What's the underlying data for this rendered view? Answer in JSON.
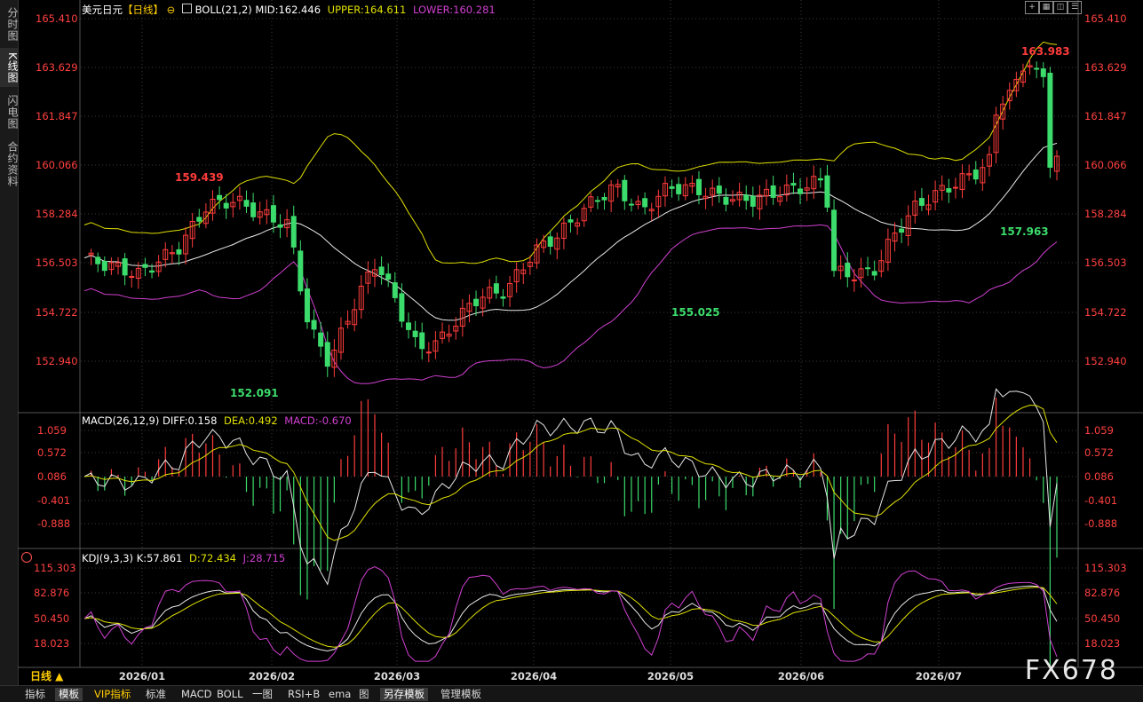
{
  "sidebar": {
    "tabs": [
      {
        "label": "分时图",
        "active": false
      },
      {
        "label": "K线图",
        "active": true
      },
      {
        "label": "闪电图",
        "active": false
      },
      {
        "label": "合约资料",
        "active": false
      }
    ]
  },
  "main_panel": {
    "symbol": "美元日元",
    "period_tag": "【日线】",
    "indicator": "BOLL(21,2)",
    "mid": "MID:162.446",
    "upper": "UPPER:164.611",
    "lower": "LOWER:160.281",
    "y_labels": [
      "165.410",
      "163.629",
      "161.847",
      "160.066",
      "158.284",
      "156.503",
      "154.722",
      "152.940"
    ],
    "annotations": [
      {
        "text": "159.439",
        "color": "#ff3c3c"
      },
      {
        "text": "152.091",
        "color": "#3cdc6c"
      },
      {
        "text": "155.025",
        "color": "#3cdc6c"
      },
      {
        "text": "163.983",
        "color": "#ff3c3c"
      },
      {
        "text": "157.963",
        "color": "#3cdc6c"
      }
    ]
  },
  "macd_panel": {
    "title": "MACD(26,12,9)",
    "diff": "DIFF:0.158",
    "dea": "DEA:0.492",
    "macd": "MACD:-0.670",
    "y_labels": [
      "1.059",
      "0.572",
      "0.086",
      "-0.401",
      "-0.888"
    ]
  },
  "kdj_panel": {
    "title": "KDJ(9,3,3)",
    "k": "K:57.861",
    "d": "D:72.434",
    "j": "J:28.715",
    "y_labels": [
      "115.303",
      "82.876",
      "50.450",
      "18.023"
    ]
  },
  "x_axis": {
    "labels": [
      "2026/01",
      "2026/02",
      "2026/03",
      "2026/04",
      "2026/05",
      "2026/06",
      "2026/07"
    ]
  },
  "period_button": "日线 ▲",
  "toolbar": {
    "items": [
      "指标",
      "模板",
      "VIP指标",
      "标准",
      "MACD",
      "BOLL",
      "一图",
      "RSI+B",
      "ema",
      "图",
      "另存模板",
      "管理模板"
    ]
  },
  "top_buttons": [
    "expand-icon",
    "layout-icon",
    "tile-icon",
    "menu-icon"
  ],
  "watermark": "FX678",
  "colors": {
    "up": "#ff3c3c",
    "down": "#3cdc6c",
    "mid_line": "#e8e8e8",
    "upper_line": "#e0e000",
    "lower_line": "#d040d0",
    "grid": "#3a3a3a",
    "axis_text": "#ff4040"
  },
  "chart_data": [
    {
      "type": "candlestick",
      "title": "美元日元【日线】",
      "ylim": [
        152.0,
        165.5
      ],
      "highlighted_points": [
        {
          "label": "high",
          "value": 159.439,
          "x": "2026/01"
        },
        {
          "label": "low",
          "value": 152.091,
          "x": "2026/01"
        },
        {
          "label": "low",
          "value": 155.025,
          "x": "2026/04"
        },
        {
          "label": "high",
          "value": 163.983,
          "x": "2026/07"
        },
        {
          "label": "low",
          "value": 157.963,
          "x": "2026/07"
        }
      ],
      "series": [
        {
          "name": "MID",
          "last": 162.446
        },
        {
          "name": "UPPER",
          "last": 164.611
        },
        {
          "name": "LOWER",
          "last": 160.281
        }
      ]
    },
    {
      "type": "bar",
      "title": "MACD(26,12,9)",
      "ylim": [
        -1.1,
        1.1
      ],
      "series": [
        {
          "name": "DIFF",
          "last": 0.158
        },
        {
          "name": "DEA",
          "last": 0.492
        },
        {
          "name": "MACD",
          "last": -0.67
        }
      ]
    },
    {
      "type": "line",
      "title": "KDJ(9,3,3)",
      "ylim": [
        0,
        125
      ],
      "series": [
        {
          "name": "K",
          "last": 57.861
        },
        {
          "name": "D",
          "last": 72.434
        },
        {
          "name": "J",
          "last": 28.715
        }
      ]
    }
  ]
}
